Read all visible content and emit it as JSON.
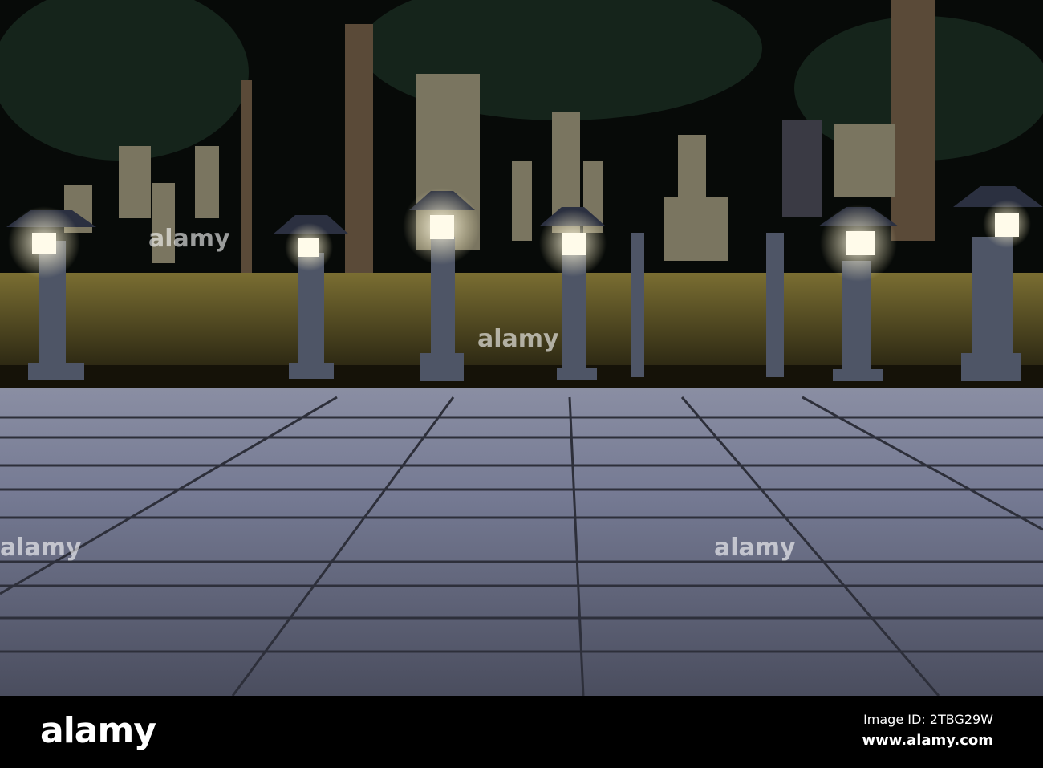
{
  "watermark": {
    "logo": "alamy",
    "text": "alamy"
  },
  "footer": {
    "image_id": "Image ID: 2TBG29W",
    "site": "www.alamy.com"
  },
  "colors": {
    "lantern_light": "#fffbea",
    "pavement": "#6f7389",
    "wall": "#6b6430"
  }
}
